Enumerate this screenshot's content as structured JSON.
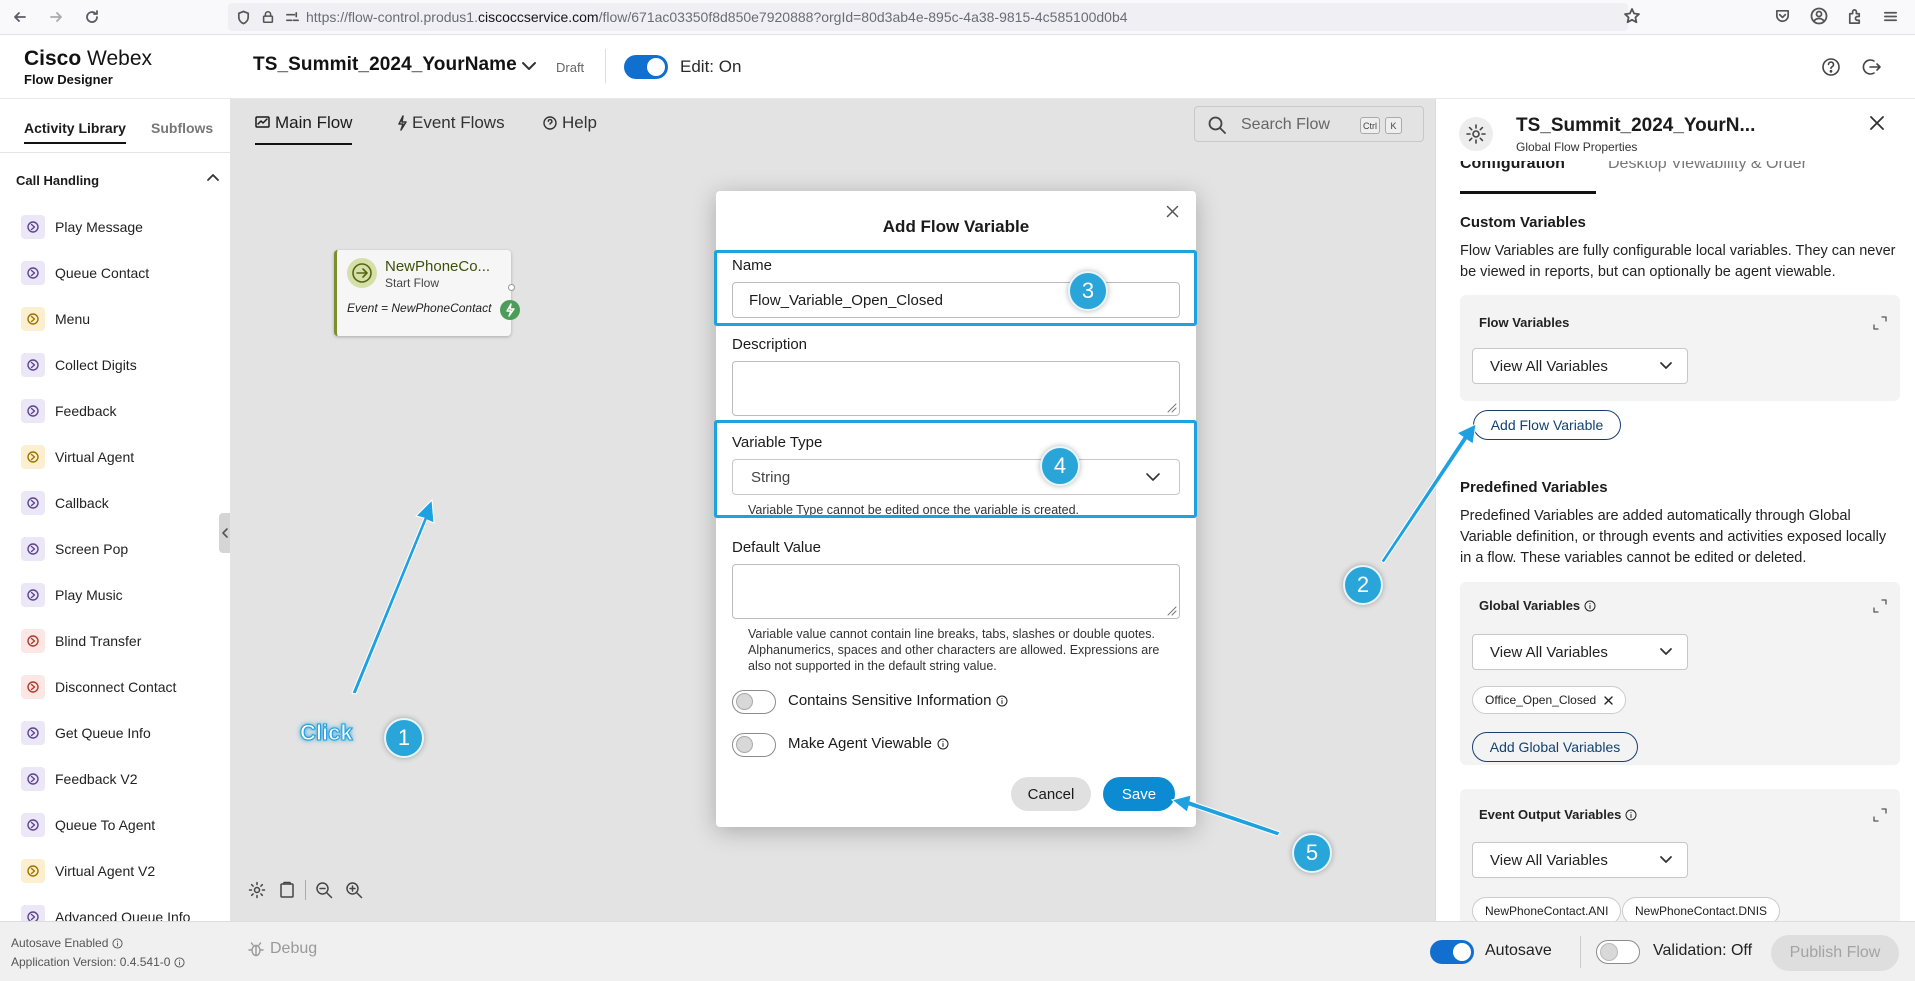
{
  "browser": {
    "url_prefix": "https://flow-control.produs1.",
    "url_domain": "ciscoccservice.com",
    "url_suffix": "/flow/671ac03350f8d850e7920888?orgId=80d3ab4e-895c-4a38-9815-4c585100d0b4"
  },
  "header": {
    "brand_line1_bold": "Cisco",
    "brand_line1_rest": " Webex",
    "brand_line2": "Flow Designer",
    "flow_name": "TS_Summit_2024_YourName",
    "draft_label": "Draft",
    "edit_label": "Edit: On"
  },
  "sidebar": {
    "tabs": [
      "Activity Library",
      "Subflows"
    ],
    "section": "Call Handling",
    "items": [
      {
        "label": "Play Message",
        "icon": "play-message-icon"
      },
      {
        "label": "Queue Contact",
        "icon": "queue-contact-icon"
      },
      {
        "label": "Menu",
        "icon": "menu-icon"
      },
      {
        "label": "Collect Digits",
        "icon": "collect-digits-icon"
      },
      {
        "label": "Feedback",
        "icon": "feedback-icon"
      },
      {
        "label": "Virtual Agent",
        "icon": "virtual-agent-icon"
      },
      {
        "label": "Callback",
        "icon": "callback-icon"
      },
      {
        "label": "Screen Pop",
        "icon": "screen-pop-icon"
      },
      {
        "label": "Play Music",
        "icon": "music-icon"
      },
      {
        "label": "Blind Transfer",
        "icon": "blind-transfer-icon"
      },
      {
        "label": "Disconnect Contact",
        "icon": "disconnect-icon"
      },
      {
        "label": "Get Queue Info",
        "icon": "get-queue-info-icon"
      },
      {
        "label": "Feedback V2",
        "icon": "feedback-icon"
      },
      {
        "label": "Queue To Agent",
        "icon": "queue-to-agent-icon"
      },
      {
        "label": "Virtual Agent V2",
        "icon": "virtual-agent-icon"
      },
      {
        "label": "Advanced Queue Info",
        "icon": "advanced-queue-info-icon"
      }
    ]
  },
  "canvas": {
    "tabs": [
      "Main Flow",
      "Event Flows",
      "Help"
    ],
    "search_placeholder": "Search Flow",
    "shortcut_keys": [
      "Ctrl",
      "K"
    ],
    "node": {
      "title": "NewPhoneCo...",
      "subtitle": "Start Flow",
      "event": "Event = NewPhoneContact"
    }
  },
  "modal": {
    "title": "Add Flow Variable",
    "name_label": "Name",
    "name_value": "Flow_Variable_Open_Closed",
    "description_label": "Description",
    "description_value": "",
    "type_label": "Variable Type",
    "type_value": "String",
    "type_help": "Variable Type cannot be edited once the variable is created.",
    "default_label": "Default Value",
    "default_value": "",
    "default_help": "Variable value cannot contain line breaks, tabs, slashes or double quotes. Alphanumerics, spaces and other characters are allowed. Expressions are also not supported in the default string value.",
    "sensitive_label": "Contains Sensitive Information",
    "viewable_label": "Make Agent Viewable",
    "cancel_label": "Cancel",
    "save_label": "Save"
  },
  "right_panel": {
    "title": "TS_Summit_2024_YourN...",
    "subtitle": "Global Flow Properties",
    "tabs": [
      "Configuration",
      "Desktop Viewability & Order"
    ],
    "custom_heading": "Custom Variables",
    "custom_desc": "Flow Variables are fully configurable local variables. They can never be viewed in reports, but can optionally be agent viewable.",
    "flow_vars_heading": "Flow Variables",
    "view_all": "View All Variables",
    "add_flow_variable": "Add Flow Variable",
    "predefined_heading": "Predefined Variables",
    "predefined_desc": "Predefined Variables are added automatically through Global Variable definition, or through events and activities exposed locally in a flow. These variables cannot be edited or deleted.",
    "global_heading": "Global Variables",
    "global_chip": "Office_Open_Closed",
    "add_global": "Add Global Variables",
    "event_heading": "Event Output Variables",
    "event_chips": [
      "NewPhoneContact.ANI",
      "NewPhoneContact.DNIS"
    ]
  },
  "bottom": {
    "autosave_status": "Autosave Enabled",
    "app_version": "Application Version: 0.4.541-0",
    "debug_label": "Debug",
    "autosave_label": "Autosave",
    "validation_label": "Validation: Off",
    "publish_label": "Publish Flow"
  },
  "annotations": {
    "badges": [
      "1",
      "2",
      "3",
      "4",
      "5"
    ],
    "click_text": "Click"
  },
  "colors": {
    "accent": "#1170cf",
    "annotation": "#1ea1e0",
    "save_button": "#0d8bd2"
  }
}
